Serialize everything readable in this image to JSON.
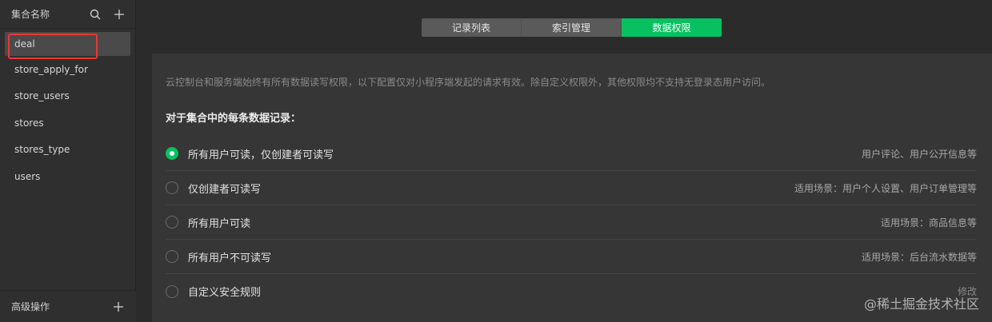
{
  "sidebar": {
    "title": "集合名称",
    "items": [
      {
        "label": "deal"
      },
      {
        "label": "store_apply_for"
      },
      {
        "label": "store_users"
      },
      {
        "label": "stores"
      },
      {
        "label": "stores_type"
      },
      {
        "label": "users"
      }
    ],
    "footer_title": "高级操作",
    "icons": [
      "search-icon",
      "plus-icon"
    ]
  },
  "tabs": [
    {
      "label": "记录列表"
    },
    {
      "label": "索引管理"
    },
    {
      "label": "数据权限"
    }
  ],
  "panel": {
    "description": "云控制台和服务端始终有所有数据读写权限，以下配置仅对小程序端发起的请求有效。除自定义权限外，其他权限均不支持无登录态用户访问。",
    "section_title": "对于集合中的每条数据记录：",
    "options": [
      {
        "label": "所有用户可读，仅创建者可读写",
        "hint": "用户评论、用户公开信息等"
      },
      {
        "label": "仅创建者可读写",
        "hint": "适用场景：用户个人设置、用户订单管理等"
      },
      {
        "label": "所有用户可读",
        "hint": "适用场景：商品信息等"
      },
      {
        "label": "所有用户不可读写",
        "hint": "适用场景：后台流水数据等"
      },
      {
        "label": "自定义安全规则",
        "hint": "修改"
      }
    ]
  },
  "watermark": "@稀土掘金技术社区",
  "colors": {
    "accent": "#07c160",
    "highlight": "#e53935",
    "background": "#2b2b2b"
  }
}
